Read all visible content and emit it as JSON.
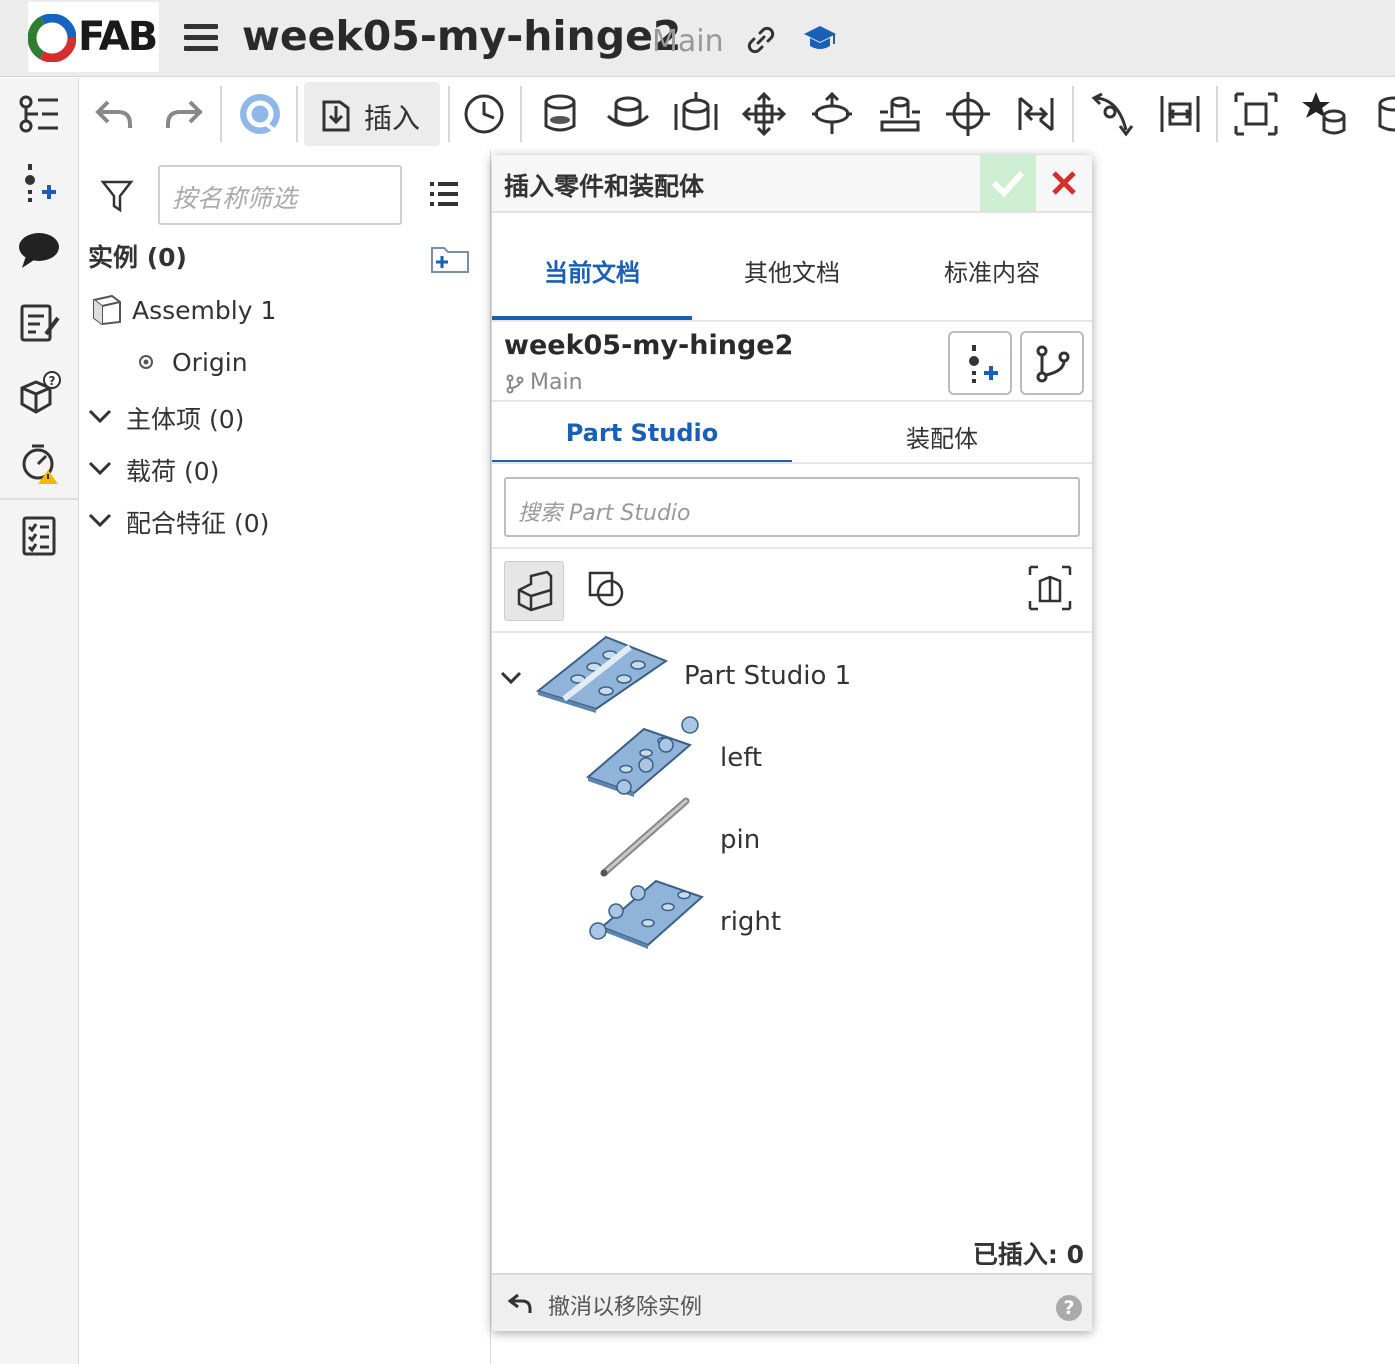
{
  "header": {
    "logo_text": "FAB",
    "document_title": "week05-my-hinge2",
    "branch": "Main"
  },
  "toolbar": {
    "insert_label": "插入"
  },
  "tree": {
    "filter_placeholder": "按名称筛选",
    "instances_label": "实例 (0)",
    "assembly_name": "Assembly 1",
    "origin_label": "Origin",
    "groups": [
      {
        "label": "主体项 (0)"
      },
      {
        "label": "载荷 (0)"
      },
      {
        "label": "配合特征 (0)"
      }
    ]
  },
  "dialog": {
    "title": "插入零件和装配体",
    "tabs": [
      {
        "label": "当前文档",
        "active": true
      },
      {
        "label": "其他文档",
        "active": false
      },
      {
        "label": "标准内容",
        "active": false
      }
    ],
    "document_name": "week05-my-hinge2",
    "document_branch": "Main",
    "sub_tabs": [
      {
        "label": "Part Studio",
        "active": true
      },
      {
        "label": "装配体",
        "active": false
      }
    ],
    "search_placeholder": "搜索 Part Studio",
    "part_studio": "Part Studio 1",
    "parts": [
      "left",
      "pin",
      "right"
    ],
    "inserted_label": "已插入: 0",
    "undo_label": "撤消以移除实例",
    "help_glyph": "?"
  },
  "colors": {
    "accent": "#1a5fb4",
    "part_blue": "#8fb3d9",
    "ok_bg": "#cdeed0",
    "cancel_red": "#d32f2f"
  }
}
